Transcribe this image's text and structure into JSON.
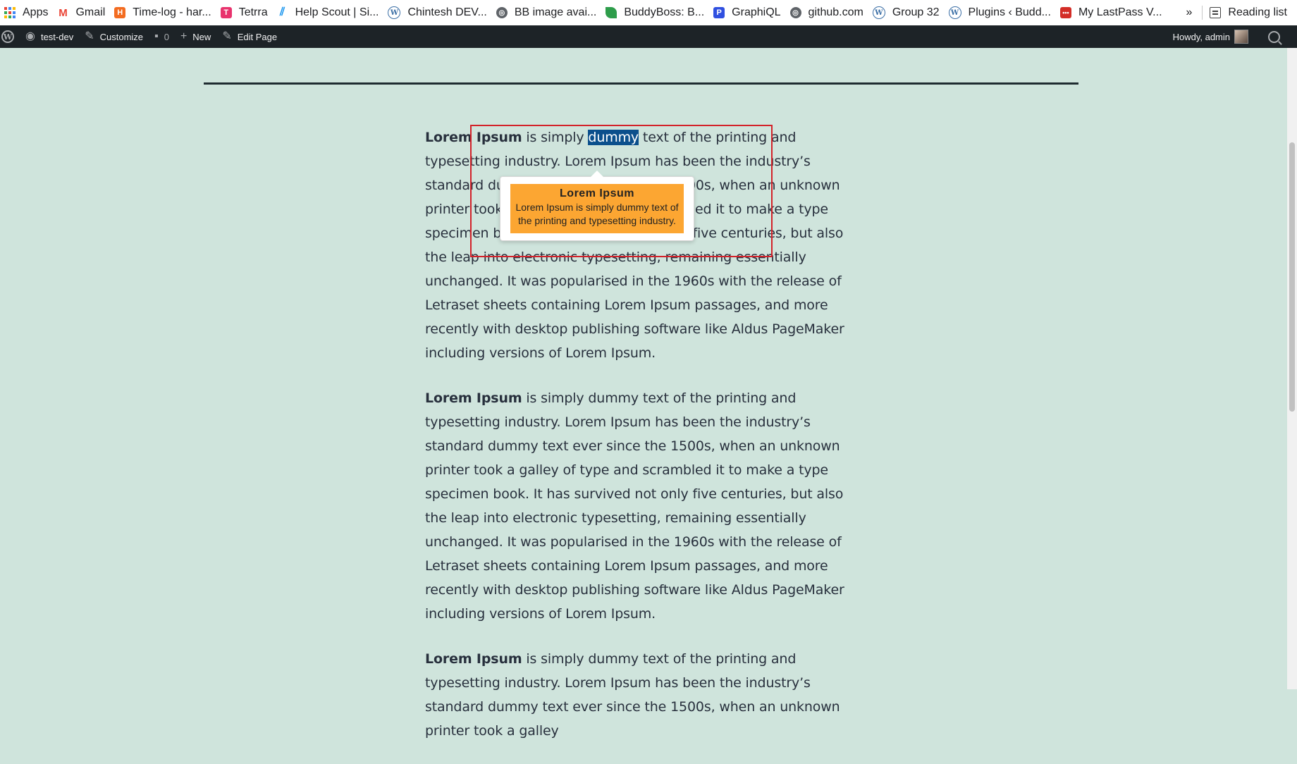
{
  "bookmarks": {
    "items": [
      {
        "label": "Apps",
        "icon": "apps-grid-icon"
      },
      {
        "label": "Gmail",
        "icon": "gmail-icon",
        "color": "#ea4335"
      },
      {
        "label": "Time-log - har...",
        "icon": "harvest-icon",
        "color": "#f36c21"
      },
      {
        "label": "Tetrra",
        "icon": "tetrra-icon",
        "color": "#e8336d"
      },
      {
        "label": "Help Scout | Si...",
        "icon": "helpscout-icon",
        "color": "#1292ee"
      },
      {
        "label": "Chintesh DEV...",
        "icon": "wordpress-icon",
        "color": "#3a6ea5"
      },
      {
        "label": "BB image avai...",
        "icon": "globe-icon",
        "color": "#5f6368"
      },
      {
        "label": "BuddyBoss: B...",
        "icon": "leaf-icon",
        "color": "#2e9d4b"
      },
      {
        "label": "GraphiQL",
        "icon": "graphiql-icon",
        "color": "#3050e0"
      },
      {
        "label": "github.com",
        "icon": "globe-icon",
        "color": "#5f6368"
      },
      {
        "label": "Group 32",
        "icon": "wordpress-icon",
        "color": "#3a6ea5"
      },
      {
        "label": "Plugins ‹ Budd...",
        "icon": "wordpress-icon",
        "color": "#3a6ea5"
      },
      {
        "label": "My LastPass V...",
        "icon": "lastpass-icon",
        "color": "#d32d27"
      }
    ],
    "overflow": "»",
    "reading_list": "Reading list"
  },
  "adminbar": {
    "site": "test-dev",
    "customize": "Customize",
    "comments_count": "0",
    "new": "New",
    "edit_page": "Edit Page",
    "howdy": "Howdy, admin"
  },
  "post": {
    "lead": "Lorem Ipsum",
    "pre": " is simply ",
    "selected": "dummy",
    "post": " text of the printing and typesetting industry. Lorem Ipsum has been the industry’s standard dummy text ever since the 1500s, when an unknown printer took a galley of type and scrambled it to make a type specimen book. It has survived not only five centuries, but also the leap into electronic typesetting, remaining essentially unchanged. It was popularised in the 1960s with the release of Letraset sheets containing Lorem Ipsum passages, and more recently with desktop publishing software like Aldus PageMaker including versions of Lorem Ipsum.",
    "rest": " is simply dummy text of the printing and typesetting industry. Lorem Ipsum has been the industry’s standard dummy text ever since the 1500s, when an unknown printer took a galley of type and scrambled it to make a type specimen book. It has survived not only five centuries, but also the leap into electronic typesetting, remaining essentially unchanged. It was popularised in the 1960s with the release of Letraset sheets containing Lorem Ipsum passages, and more recently with desktop publishing software like Aldus PageMaker including versions of Lorem Ipsum.",
    "rest3": " is simply dummy text of the printing and typesetting industry. Lorem Ipsum has been the industry’s standard dummy text ever since the 1500s, when an unknown printer took a galley"
  },
  "tooltip": {
    "title": "Lorem Ipsum",
    "body": "Lorem Ipsum is simply dummy text of the printing and typesetting industry."
  },
  "colors": {
    "page_bg": "#cfe4dc",
    "selection": "#0b4f8c",
    "tooltip_fill": "#fca632",
    "highlight_box": "#d3222a",
    "adminbar_bg": "#1d2327"
  }
}
